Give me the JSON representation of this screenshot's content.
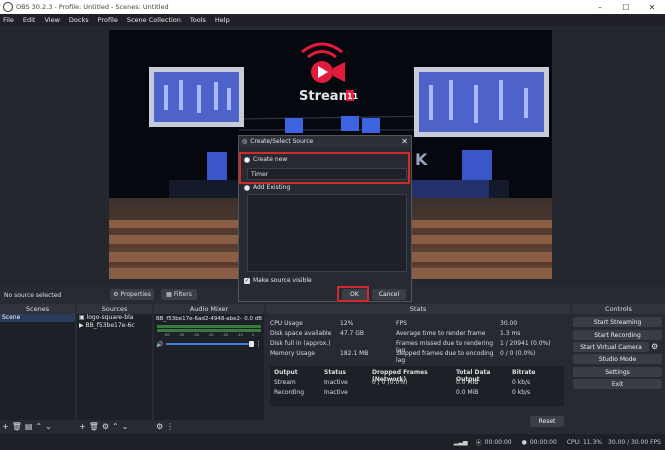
{
  "window": {
    "title": "OBS 30.2.3 - Profile: Untitled - Scenes: Untitled",
    "min_icon": "minimize-icon",
    "max_icon": "maximize-icon",
    "close_icon": "close-icon"
  },
  "menu": [
    "File",
    "Edit",
    "View",
    "Docks",
    "Profile",
    "Scene Collection",
    "Tools",
    "Help"
  ],
  "preview": {
    "logo_text": "Stream",
    "logo_badge": "11",
    "side_letter": "K"
  },
  "source_bar": {
    "no_source": "No source selected",
    "properties": "Properties",
    "filters": "Filters"
  },
  "docks": {
    "scenes": {
      "title": "Scenes",
      "items": [
        "Scene"
      ]
    },
    "sources": {
      "title": "Sources",
      "items": [
        "logo-square-bla",
        "BB_f53be17e-6c"
      ]
    },
    "mixer": {
      "title": "Audio Mixer",
      "channel": "BB_f53be17e-6ad2-4948-abe2-",
      "level": "0.0 dB",
      "ticks": [
        "-60",
        "-55",
        "-50",
        "-45",
        "-40",
        "-35",
        "-30",
        "-25",
        "-20",
        "-15",
        "-10",
        "-5",
        "0"
      ]
    },
    "stats": {
      "title": "Stats",
      "left": [
        {
          "label": "CPU Usage",
          "value": "12%"
        },
        {
          "label": "Disk space available",
          "value": "47.7 GB"
        },
        {
          "label": "Disk full in (approx.)",
          "value": ""
        },
        {
          "label": "Memory Usage",
          "value": "182.1 MB"
        }
      ],
      "right": [
        {
          "label": "FPS",
          "value": "30.00"
        },
        {
          "label": "Average time to render frame",
          "value": "1.3 ms"
        },
        {
          "label": "Frames missed due to rendering lag",
          "value": "1 / 20941 (0.0%)"
        },
        {
          "label": "Skipped frames due to encoding lag",
          "value": "0 / 0 (0.0%)"
        }
      ],
      "table_headers": [
        "Output",
        "Status",
        "Dropped Frames (Network)",
        "Total Data Output",
        "Bitrate"
      ],
      "rows": [
        [
          "Stream",
          "Inactive",
          "0 / 0 (0.0%)",
          "0.0 MiB",
          "0 kb/s"
        ],
        [
          "Recording",
          "Inactive",
          "",
          "0.0 MiB",
          "0 kb/s"
        ]
      ],
      "reset": "Reset"
    },
    "controls": {
      "title": "Controls",
      "buttons": [
        "Start Streaming",
        "Start Recording",
        "Start Virtual Camera",
        "Studio Mode",
        "Settings",
        "Exit"
      ]
    }
  },
  "dialog": {
    "title": "Create/Select Source",
    "create_new": "Create new",
    "name_value": "Timer",
    "add_existing": "Add Existing",
    "make_visible": "Make source visible",
    "ok": "OK",
    "cancel": "Cancel"
  },
  "status": {
    "live_time": "00:00:00",
    "rec_time": "00:00:00",
    "cpu": "CPU: 11.3%",
    "fps": "30.00 / 30.00 FPS"
  },
  "colors": {
    "accent_red": "#d02a2a",
    "logo_red": "#e11b3c",
    "bg": "#272a33"
  }
}
